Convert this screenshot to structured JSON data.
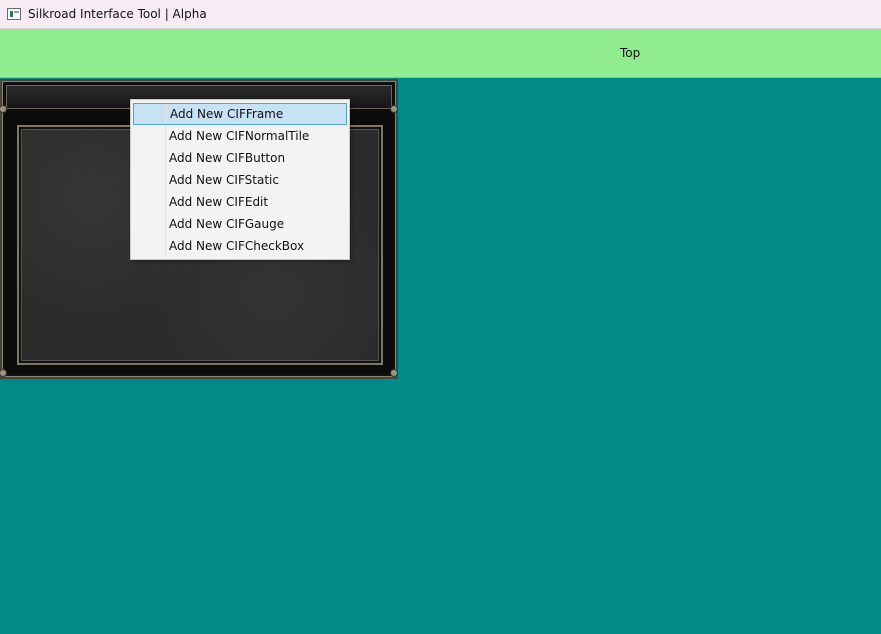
{
  "window": {
    "title": "Silkroad Interface Tool | Alpha",
    "icon": "app-window-icon"
  },
  "topbar": {
    "label": "Top",
    "color": "#90ee90"
  },
  "canvas": {
    "background": "#008a88"
  },
  "context_menu": {
    "items": [
      {
        "label": "Add New CIFFrame",
        "highlighted": true
      },
      {
        "label": "Add New CIFNormalTile"
      },
      {
        "label": "Add New CIFButton"
      },
      {
        "label": "Add New CIFStatic"
      },
      {
        "label": "Add New CIFEdit"
      },
      {
        "label": "Add New CIFGauge"
      },
      {
        "label": "Add New CIFCheckBox"
      }
    ]
  }
}
